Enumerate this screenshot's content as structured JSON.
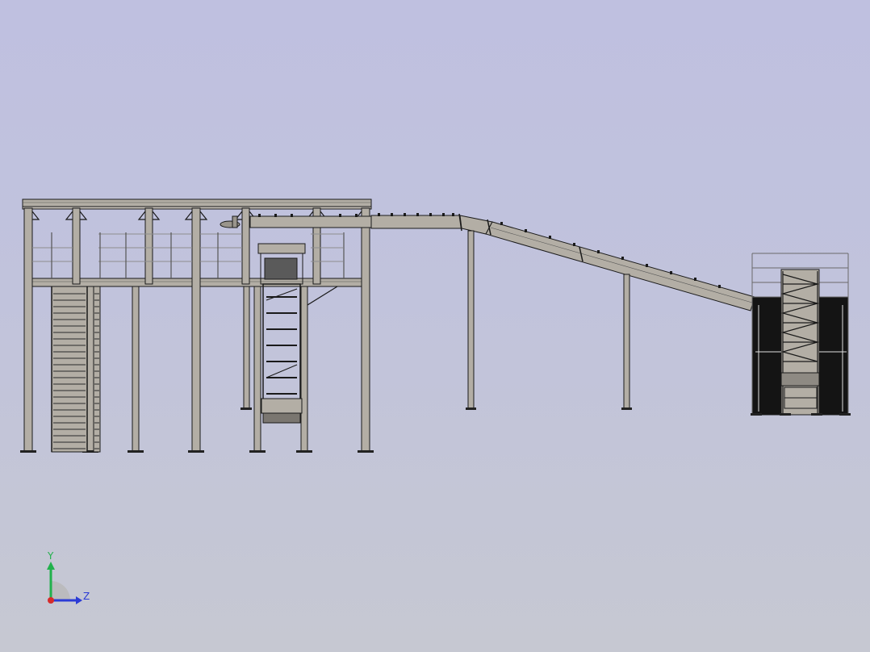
{
  "viewport": {
    "background_top": "#bfc0e0",
    "background_bottom": "#c6c8d2"
  },
  "model": {
    "steel_color": "#b3aea5",
    "edge_color": "#1a1a1a",
    "dark_fill": "#141414",
    "rail_color": "#8e8e8e"
  },
  "triad": {
    "y_label": "Y",
    "z_label": "Z",
    "y_color": "#22b14c",
    "z_color": "#2b3bd6",
    "x_color": "#d62b2b"
  }
}
